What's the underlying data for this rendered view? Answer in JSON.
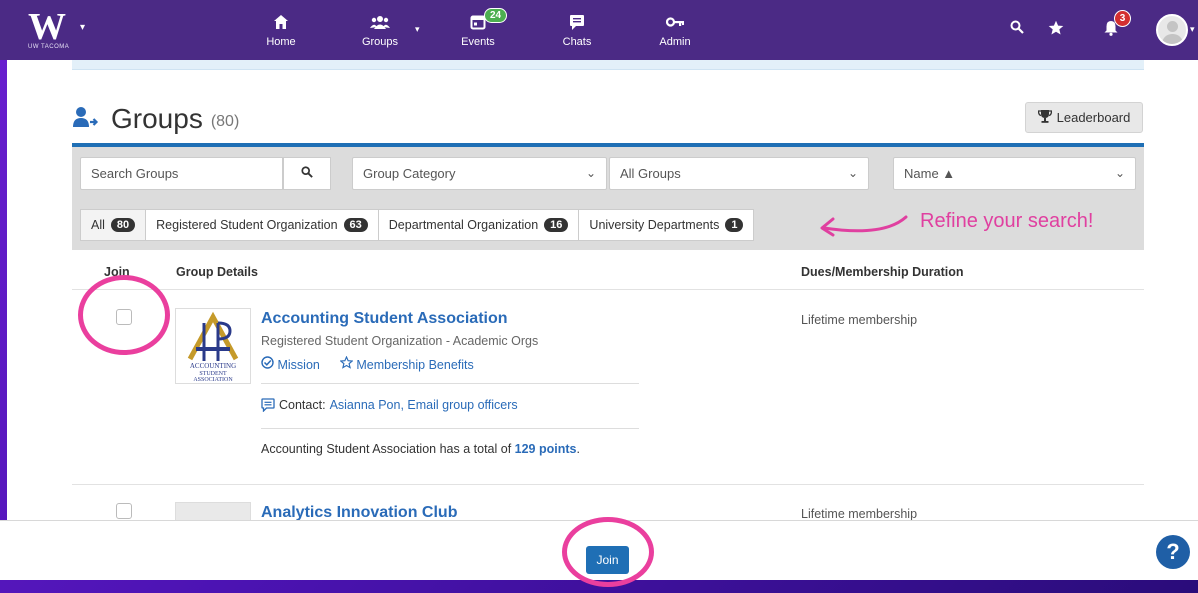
{
  "nav": {
    "logo": "W",
    "logo_sub": "UW TACOMA",
    "items": [
      {
        "label": "Home",
        "icon": "home-icon"
      },
      {
        "label": "Groups",
        "icon": "groups-icon"
      },
      {
        "label": "Events",
        "icon": "calendar-icon",
        "count": "24"
      },
      {
        "label": "Chats",
        "icon": "chat-icon"
      },
      {
        "label": "Admin",
        "icon": "key-icon"
      }
    ],
    "notifications_count": "3"
  },
  "page": {
    "title": "Groups",
    "count": "(80)",
    "leaderboard_label": "Leaderboard"
  },
  "filters": {
    "search_placeholder": "Search Groups",
    "category": "Group Category",
    "scope": "All Groups",
    "sort": "Name ▲"
  },
  "tabs": [
    {
      "label": "All",
      "count": "80"
    },
    {
      "label": "Registered Student Organization",
      "count": "63"
    },
    {
      "label": "Departmental Organization",
      "count": "16"
    },
    {
      "label": "University Departments",
      "count": "1"
    }
  ],
  "annotation": "Refine your search!",
  "table": {
    "headers": {
      "join": "Join",
      "details": "Group Details",
      "dues": "Dues/Membership Duration"
    },
    "rows": [
      {
        "name": "Accounting Student Association",
        "type": "Registered Student Organization - Academic Orgs",
        "links": [
          "Mission",
          "Membership Benefits"
        ],
        "contact_label": "Contact:",
        "contact_link": "Asianna Pon, Email group officers",
        "points_prefix": "Accounting Student Association has a total of",
        "points": "129 points",
        "points_suffix": ".",
        "logo_text": [
          "ACCOUNTING",
          "STUDENT",
          "ASSOCIATION"
        ],
        "dues": "Lifetime membership"
      },
      {
        "name": "Analytics Innovation Club",
        "dues": "Lifetime membership"
      }
    ]
  },
  "bottom": {
    "join_label": "Join",
    "help": "?"
  },
  "colors": {
    "nav_bg": "#4b2a85",
    "accent_blue": "#1f6fb5",
    "link_blue": "#2a6bb8",
    "annotation_pink": "#ea3f9e"
  }
}
